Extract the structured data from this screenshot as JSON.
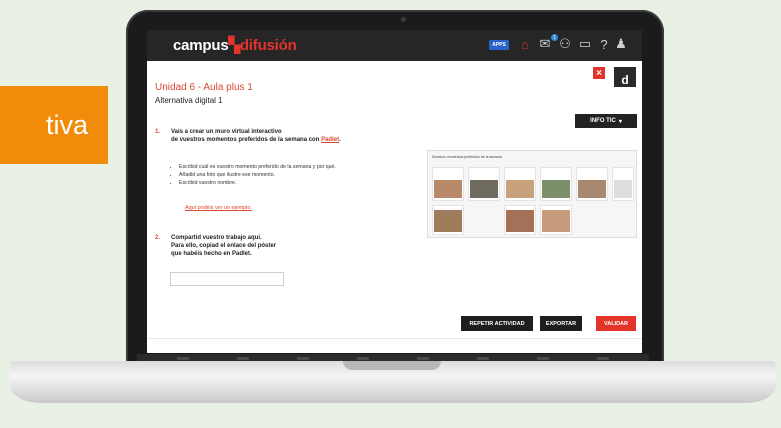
{
  "side_tag": "tiva",
  "header": {
    "brand_part1": "campus",
    "brand_part2": "difusión",
    "apps_label": "APPS",
    "notification_count": "1"
  },
  "activity": {
    "unit_title": "Unidad 6 - Aula plus 1",
    "subtitle": "Alternativa digital 1",
    "info_button": "INFO TIC",
    "logo_letter": "d",
    "close_symbol": "×"
  },
  "step1": {
    "number": "1.",
    "line1": "Vais a crear un muro virtual interactivo",
    "line2_prefix": "de vuestros momentos preferidos de la semana con",
    "line2_link": "Padlet",
    "line2_suffix": ".",
    "bullets": [
      "Escribid cuál es vuestro momento preferido de la semana y por qué.",
      "Añadid una foto que ilustre ese momento.",
      "Escribid vuestro nombre."
    ],
    "example_link": "Aquí podéis ver un ejemplo."
  },
  "step2": {
    "number": "2.",
    "line1": "Compartid vuestro trabajo aquí.",
    "line2": "Para ello, copiad el enlace del póster",
    "line3": "que habéis hecho en Padlet."
  },
  "preview": {
    "header_text": "Nuestros momentos preferidos de la semana"
  },
  "actions": {
    "repeat": "REPETIR ACTIVIDAD",
    "export": "EXPORTAR",
    "validate": "VALIDAR"
  },
  "colors": {
    "accent_red": "#e3342c",
    "orange_tag": "#f08c0a",
    "topbar": "#262626"
  }
}
